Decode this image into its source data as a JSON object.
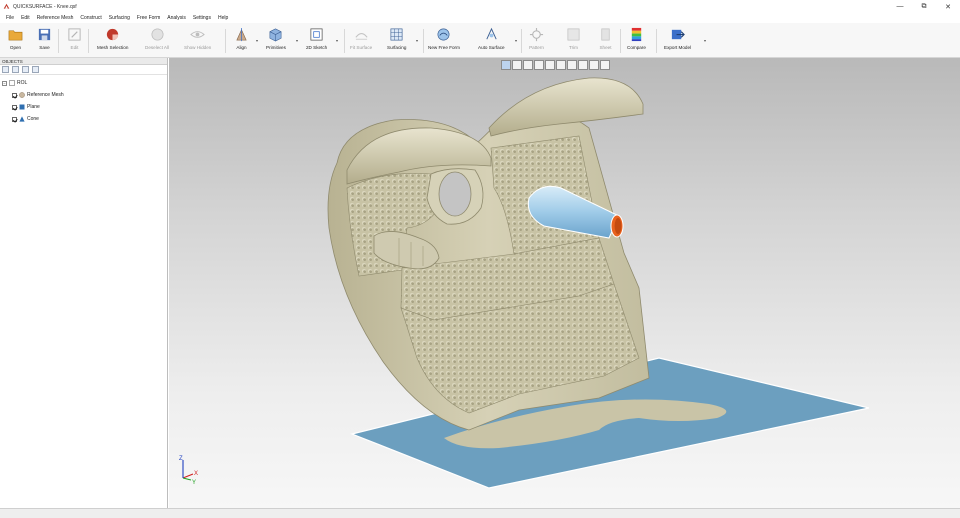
{
  "window": {
    "title": "QUICKSURFACE - Knee.qsf",
    "controls": [
      "—",
      "⧉",
      "✕"
    ]
  },
  "menu": [
    "File",
    "Edit",
    "Reference Mesh",
    "Construct",
    "Surfacing",
    "Free Form",
    "Analysis",
    "Settings",
    "Help"
  ],
  "toolbar": {
    "open": "Open",
    "save": "Save",
    "edit": "Edit",
    "mesh_selection": "Mesh Selection",
    "deselect_all": "Deselect All",
    "show_hidden": "Show Hidden",
    "align": "Align",
    "primitives": "Primitives",
    "sketch_2d": "2D Sketch",
    "fit_surface": "Fit Surface",
    "surfacing": "Surfacing",
    "new_free_form": "New Free Form",
    "auto_surface": "Auto Surface",
    "pattern": "Pattern",
    "trim": "Trim",
    "sheet": "Sheet",
    "compare": "Compare",
    "export_model": "Export Model"
  },
  "objects_panel": {
    "header": "OBJECTS",
    "tree": {
      "root": "ROL",
      "items": [
        "Reference Mesh",
        "Plane",
        "Cone"
      ]
    }
  },
  "axis": {
    "x": "X",
    "y": "Y",
    "z": "Z"
  },
  "colors": {
    "mesh": "#cfcaae",
    "plane": "#6c9fbf",
    "cone": "#a9cfe8",
    "cone_cap": "#e8621e",
    "axis_x": "#d02020",
    "axis_y": "#20a020",
    "axis_z": "#2040c0"
  }
}
